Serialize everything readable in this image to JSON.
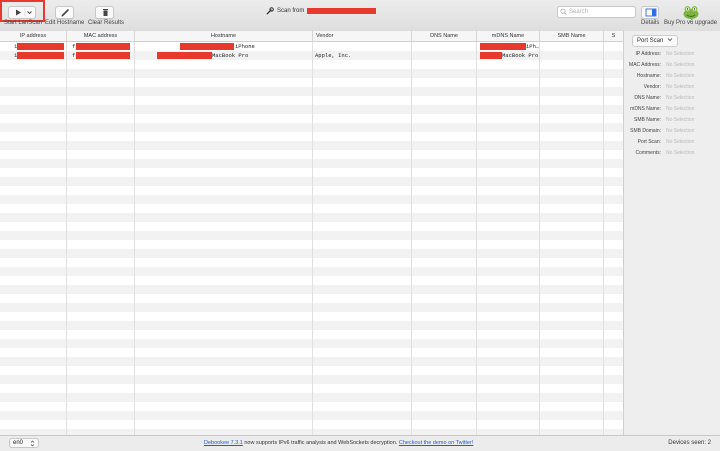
{
  "toolbar": {
    "start_label": "Start LanScan",
    "edit_label": "Edit Hostname",
    "clear_label": "Clear Results",
    "scan_from_label": "Scan from",
    "search_placeholder": "Search",
    "details_label": "Details",
    "buy_label": "Buy Pro v6 upgrade"
  },
  "table": {
    "columns": [
      "IP address",
      "MAC address",
      "Hostname",
      "Vendor",
      "DNS Name",
      "mDNS Name",
      "SMB Name",
      "S"
    ],
    "rows": [
      {
        "ip": "1",
        "mac": "f",
        "hostname": "iPhone",
        "vendor": "",
        "dns": "",
        "mdns": "iPh…",
        "smb": ""
      },
      {
        "ip": "1",
        "mac": "f",
        "hostname": "MacBook Pro",
        "vendor": "Apple, Inc.",
        "dns": "",
        "mdns": "MacBook Pro",
        "smb": ""
      }
    ]
  },
  "details": {
    "port_scan": "Port Scan",
    "fields": [
      {
        "label": "IP Address:",
        "value": "No Selection"
      },
      {
        "label": "MAC Address:",
        "value": "No Selection"
      },
      {
        "label": "Hostname:",
        "value": "No Selection"
      },
      {
        "label": "Vendor:",
        "value": "No Selection"
      },
      {
        "label": "DNS Name:",
        "value": "No Selection"
      },
      {
        "label": "mDNS Name:",
        "value": "No Selection"
      },
      {
        "label": "SMB Name:",
        "value": "No Selection"
      },
      {
        "label": "SMB Domain:",
        "value": "No Selection"
      },
      {
        "label": "Port Scan:",
        "value": "No Selection"
      },
      {
        "label": "Comments:",
        "value": "No Selection"
      }
    ]
  },
  "statusbar": {
    "interface": "en0",
    "news_link1": "Debookee 7.3.1",
    "news_text": " now supports IPv6 traffic analysis and WebSockets decryption. ",
    "news_link2": "Checkout the demo on Twitter!",
    "devices": "Devices seen: 2"
  },
  "colors": {
    "accent": "#e8392d",
    "link": "#1a5fd6",
    "mascot": "#7cb342"
  }
}
